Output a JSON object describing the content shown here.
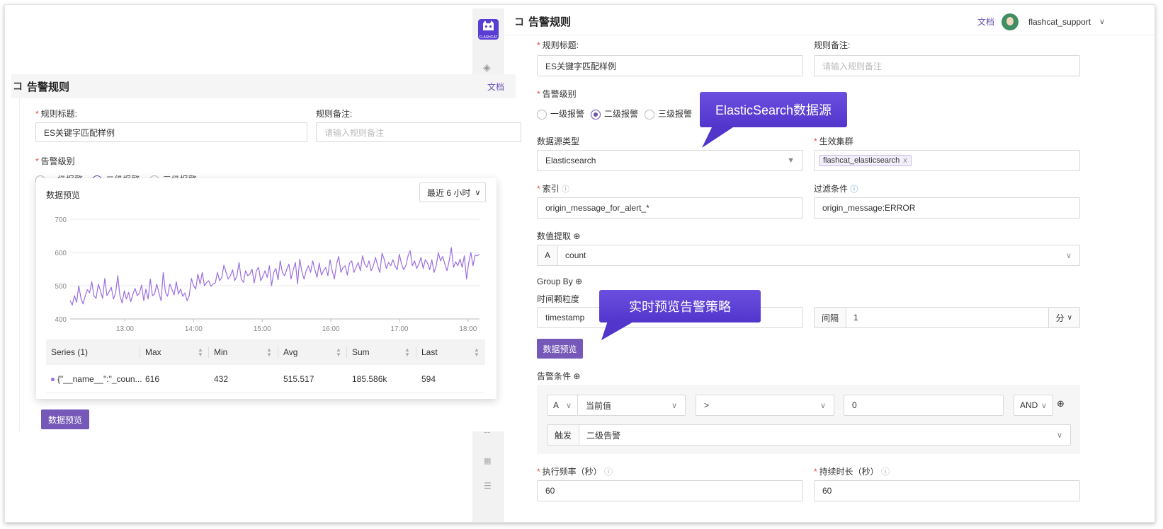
{
  "page": {
    "title": "告警规则",
    "docs_link": "文档",
    "username": "flashcat_support",
    "logo_text": "FLASHCAT"
  },
  "form": {
    "rule_title_label": "规则标题:",
    "rule_title_value": "ES关键字匹配样例",
    "rule_note_label": "规则备注:",
    "rule_note_placeholder": "请输入规则备注",
    "level_label": "告警级别",
    "levels": [
      "一级报警",
      "二级报警",
      "三级报警"
    ],
    "level_selected": "二级报警",
    "datasource_type_label": "数据源类型",
    "datasource_type_value": "Elasticsearch",
    "cluster_label": "生效集群",
    "cluster_tag": "flashcat_elasticsearch",
    "index_label": "索引",
    "index_value": "origin_message_for_alert_*",
    "filter_label": "过滤条件",
    "filter_value": "origin_message:ERROR",
    "value_extract_label": "数值提取",
    "value_extract_prefix": "A",
    "value_extract_value": "count",
    "group_by_label": "Group By",
    "time_granularity_label": "时间颗粒度",
    "time_field_value": "timestamp",
    "interval_label": "间隔",
    "interval_value": "1",
    "interval_unit": "分",
    "preview_button": "数据预览",
    "alert_condition_label": "告警条件",
    "cond_var": "A",
    "cond_func": "当前值",
    "cond_op": ">",
    "cond_value": "0",
    "cond_logic": "AND",
    "trigger_label": "触发",
    "trigger_value": "二级告警",
    "exec_freq_label": "执行频率（秒）",
    "exec_freq_value": "60",
    "duration_label": "持续时长（秒）",
    "duration_value": "60"
  },
  "callouts": {
    "es_source": "ElasticSearch数据源",
    "live_preview": "实时预览告警策略"
  },
  "preview_panel": {
    "title": "数据预览",
    "range_label": "最近 6 小时",
    "table_headers": [
      "Series (1)",
      "Max",
      "Min",
      "Avg",
      "Sum",
      "Last"
    ],
    "table_row": {
      "series": "{\"__name__\":\"_coun...",
      "max": "616",
      "min": "432",
      "avg": "515.517",
      "sum": "185.586k",
      "last": "594"
    }
  },
  "colors": {
    "accent": "#7658b8",
    "callout": "#5a3ed4",
    "line": "#9b6ee0",
    "required": "#e74c3c"
  },
  "chart_data": {
    "type": "line",
    "yticks": [
      "700",
      "600",
      "500",
      "400"
    ],
    "ylim": [
      400,
      700
    ],
    "xticks": [
      "13:00",
      "14:00",
      "15:00",
      "16:00",
      "17:00",
      "18:00"
    ],
    "x_range": [
      "12:12",
      "18:10"
    ],
    "series": [
      {
        "values": [
          455,
          442,
          470,
          450,
          500,
          462,
          445,
          470,
          488,
          478,
          512,
          470,
          462,
          505,
          485,
          462,
          522,
          470,
          482,
          495,
          460,
          478,
          530,
          470,
          448,
          485,
          460,
          480,
          452,
          475,
          492,
          470,
          478,
          502,
          455,
          490,
          460,
          520,
          470,
          475,
          505,
          478,
          455,
          540,
          480,
          468,
          505,
          490,
          472,
          512,
          475,
          490,
          468,
          478,
          455,
          470,
          522,
          500,
          490,
          535,
          505,
          540,
          500,
          510,
          515,
          498,
          505,
          508,
          540,
          515,
          525,
          562,
          540,
          520,
          530,
          548,
          515,
          530,
          570,
          520,
          510,
          545,
          530,
          535,
          550,
          508,
          545,
          555,
          515,
          528,
          545,
          525,
          560,
          500,
          540,
          552,
          518,
          575,
          540,
          530,
          548,
          565,
          520,
          548,
          570,
          505,
          580,
          542,
          520,
          545,
          560,
          540,
          575,
          548,
          525,
          568,
          532,
          545,
          555,
          530,
          578,
          545,
          520,
          565,
          588,
          540,
          555,
          560,
          532,
          568,
          575,
          540,
          555,
          570,
          545,
          590,
          565,
          555,
          575,
          545,
          560,
          585,
          560,
          540,
          598,
          580,
          552,
          570,
          560,
          578,
          560,
          548,
          595,
          565,
          548,
          560,
          590,
          605,
          560,
          575,
          552,
          565,
          585,
          552,
          578,
          568,
          548,
          578,
          540,
          560,
          600,
          575,
          588,
          565,
          545,
          575,
          615,
          555,
          572,
          560,
          580,
          555,
          590,
          520,
          568,
          600,
          560,
          592,
          590,
          595
        ]
      }
    ]
  }
}
